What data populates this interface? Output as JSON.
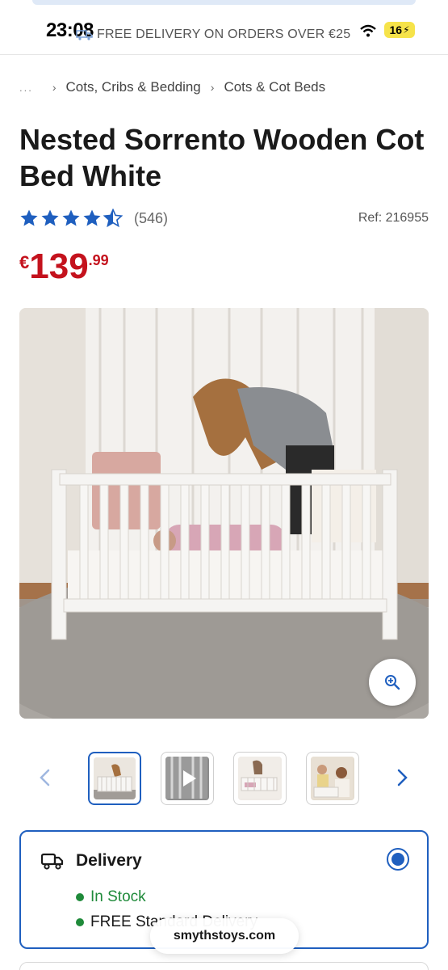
{
  "status_bar": {
    "time": "23:08",
    "promo_text": "FREE DELIVERY ON ORDERS OVER €25",
    "battery": "16"
  },
  "breadcrumb": {
    "ellipsis": "...",
    "items": [
      "Cots, Cribs & Bedding",
      "Cots & Cot Beds"
    ]
  },
  "product": {
    "title": "Nested Sorrento Wooden Cot Bed White",
    "rating_stars": 4.5,
    "reviews": "(546)",
    "ref": "Ref: 216955",
    "price": {
      "currency": "€",
      "whole": "139",
      "cents": ".99"
    }
  },
  "gallery": {
    "thumbnails": [
      {
        "kind": "image",
        "active": true
      },
      {
        "kind": "video",
        "active": false
      },
      {
        "kind": "image",
        "active": false
      },
      {
        "kind": "image",
        "active": false
      }
    ]
  },
  "delivery": {
    "label": "Delivery",
    "stock": "In Stock",
    "shipping": "FREE Standard Delivery"
  },
  "browser": {
    "url": "smythstoys.com"
  },
  "colors": {
    "accent": "#1f5fbf",
    "price": "#c4121d",
    "stock": "#1f8a3a",
    "star": "#1f5fbf"
  }
}
